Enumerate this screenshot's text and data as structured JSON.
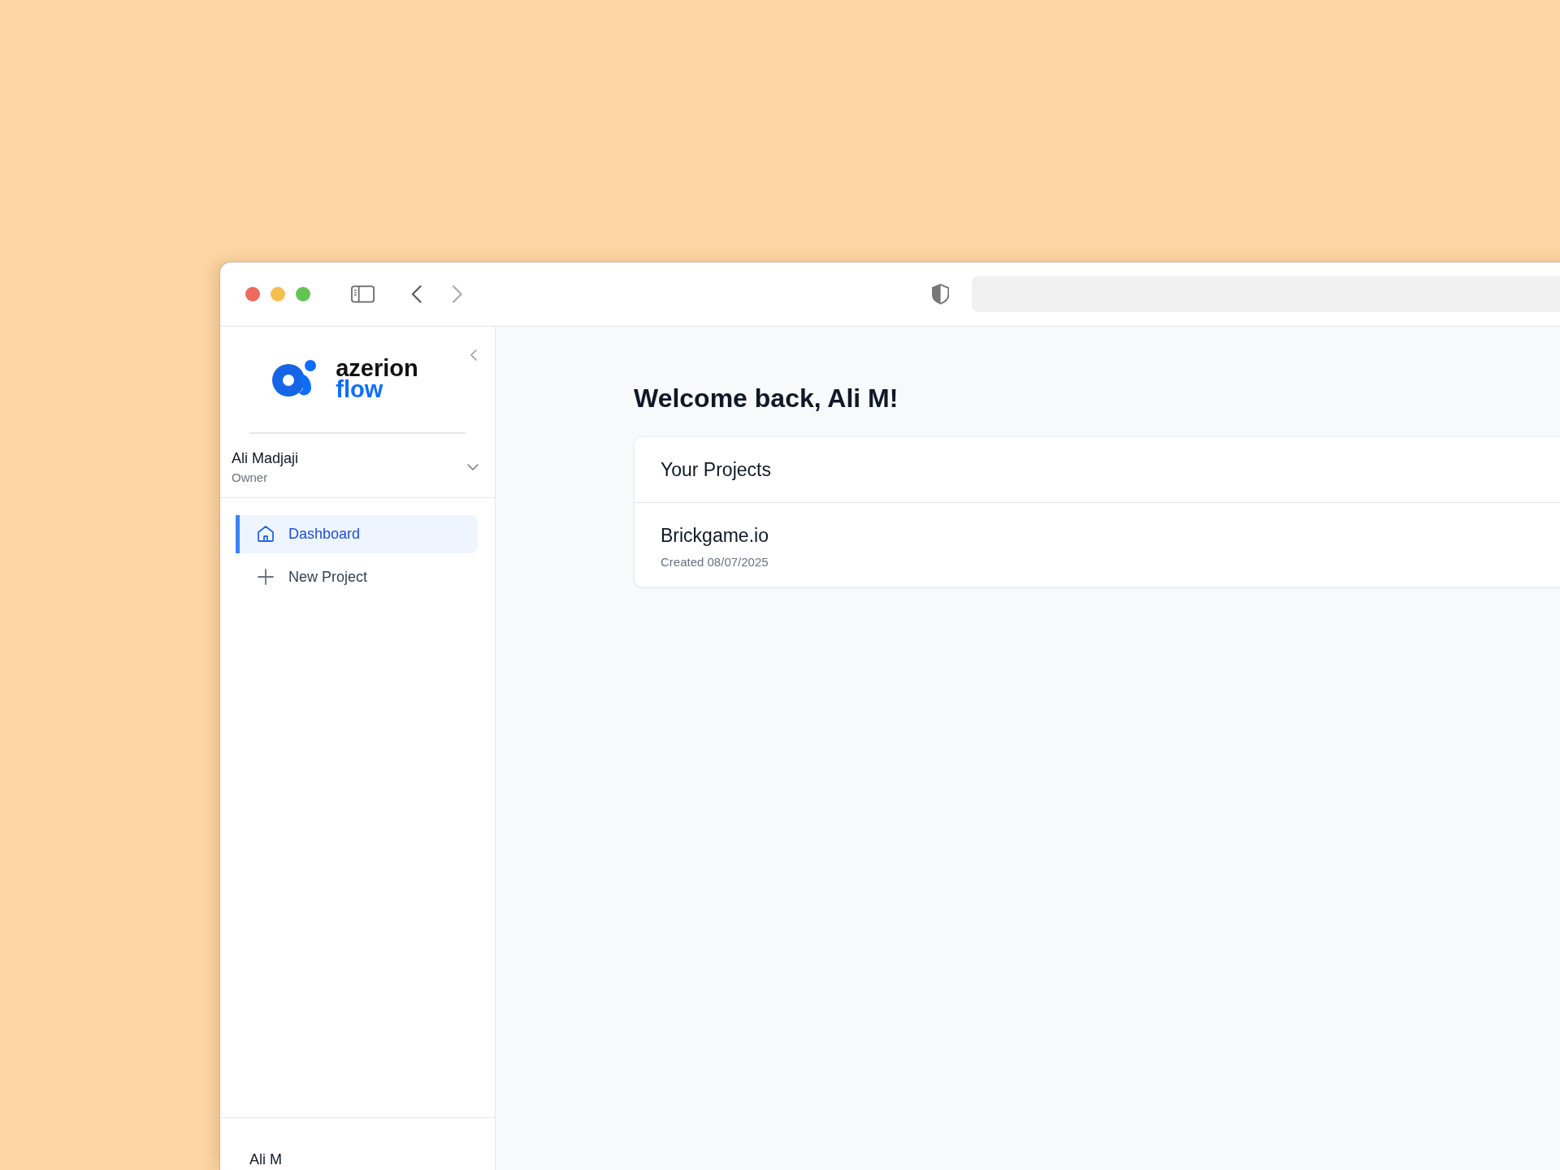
{
  "logo": {
    "name": "azerion",
    "product": "flow"
  },
  "user": {
    "name": "Ali Madjaji",
    "role": "Owner"
  },
  "nav": [
    {
      "kind": "home",
      "label": "Dashboard",
      "selected": true
    },
    {
      "kind": "add",
      "label": "New Project",
      "selected": false
    }
  ],
  "footer_user": "Ali M",
  "heading": "Welcome back, Ali M!",
  "projects": {
    "title": "Your Projects",
    "items": [
      {
        "name": "Brickgame.io",
        "created": "Created 08/07/2025"
      }
    ]
  }
}
